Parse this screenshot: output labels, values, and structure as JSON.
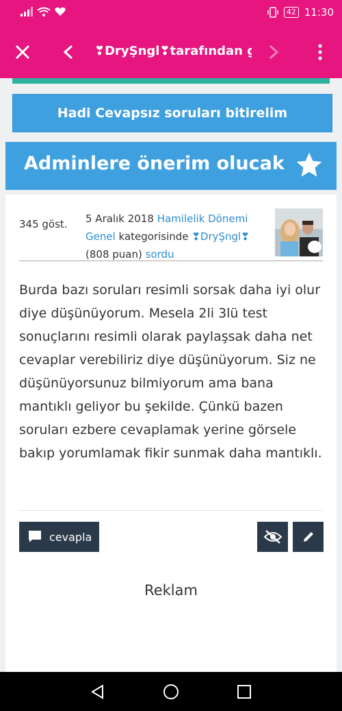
{
  "status_bar": {
    "time": "11:30",
    "battery": "42",
    "icons": [
      "signal-icon",
      "wifi-icon",
      "heart-icon",
      "vibrate-icon",
      "battery-icon"
    ]
  },
  "app_bar": {
    "title": "❣DryŞngl❣tarafından g...",
    "icons": [
      "close-icon",
      "back-icon",
      "forward-icon",
      "more-icon"
    ]
  },
  "banner": {
    "label": "Hadi Cevapsız soruları bitirelim"
  },
  "question": {
    "title": "Adminlere önerim olucak",
    "views": "345 göst.",
    "date": "5 Aralık 2018",
    "category": "Hamilelik Dönemi Genel",
    "category_suffix": "kategorisinde",
    "author": "❣DryŞngl❣",
    "points": "(808 puan)",
    "action": "sordu",
    "body": "Burda bazı soruları resimli sorsak daha iyi olur diye düşünüyorum. Mesela 2li 3lü test sonuçlarını resimli olarak paylaşsak daha net cevaplar verebiliriz diye düşünüyorum. Siz ne düşünüyorsunuz bilmiyorum ama bana mantıklı geliyor bu şekilde. Çünkü bazen soruları ezbere cevaplamak yerine görsele bakıp yorumlamak fikir sunmak daha mantıklı."
  },
  "actions": {
    "reply_label": "cevapla"
  },
  "ad": {
    "label": "Reklam"
  },
  "colors": {
    "brand": "#e6157f",
    "accent": "#3fa0e0",
    "teal": "#2bb3a0",
    "dark_button": "#2b3a4a",
    "link": "#2d8dd0"
  }
}
